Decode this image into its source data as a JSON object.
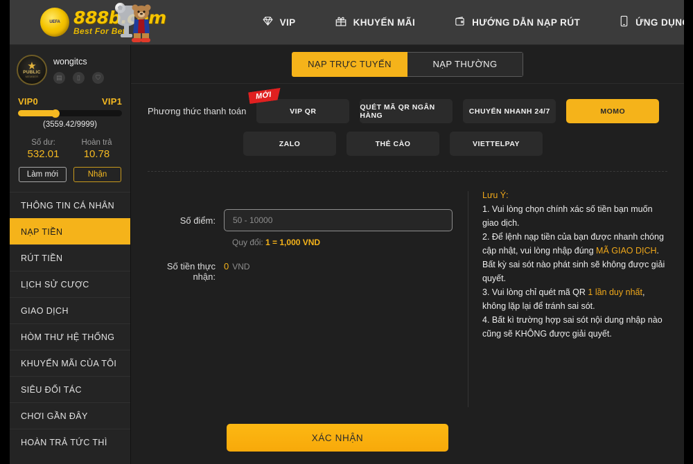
{
  "brand": {
    "name": "888b.com",
    "tagline": "Best For Bet",
    "badge_text": "UEFA",
    "logo_icon": "soccer-ball-icon",
    "mascot_icon": "bear-mascot-icon"
  },
  "header": {
    "nav": [
      {
        "label": "VIP",
        "icon": "diamond-icon"
      },
      {
        "label": "KHUYẾN MÃI",
        "icon": "gift-icon"
      },
      {
        "label": "HƯỚNG DẪN NẠP RÚT",
        "icon": "wallet-icon"
      },
      {
        "label": "ỨNG DỤNG",
        "icon": "mobile-icon"
      }
    ]
  },
  "sidebar": {
    "profile": {
      "username": "wongitcs",
      "avatar_star": "★",
      "avatar_label": "PUBLIC",
      "avatar_sub": "MEMBER",
      "badges": [
        "card-badge-icon",
        "phone-badge-icon",
        "bank-badge-icon"
      ]
    },
    "vip": {
      "current": "VIP0",
      "next": "VIP1",
      "progress_text": "(3559.42/9999)",
      "progress_percent": 36
    },
    "balance": {
      "balance_label": "Số dư:",
      "balance_value": "532.01",
      "rebate_label": "Hoàn trả",
      "rebate_value": "10.78"
    },
    "buttons": {
      "refresh": "Làm mới",
      "claim": "Nhận"
    },
    "menu": [
      {
        "label": "THÔNG TIN CÁ NHÂN",
        "active": false
      },
      {
        "label": "NẠP TIỀN",
        "active": true
      },
      {
        "label": "RÚT TIỀN",
        "active": false
      },
      {
        "label": "LỊCH SỬ CƯỢC",
        "active": false
      },
      {
        "label": "GIAO DỊCH",
        "active": false
      },
      {
        "label": "HÒM THƯ HỆ THỐNG",
        "active": false
      },
      {
        "label": "KHUYẾN MÃI CỦA TÔI",
        "active": false
      },
      {
        "label": "SIÊU ĐỐI TÁC",
        "active": false
      },
      {
        "label": "CHƠI GẦN ĐÂY",
        "active": false
      },
      {
        "label": "HOÀN TRẢ TỨC THÌ",
        "active": false
      }
    ]
  },
  "main": {
    "tabs": [
      {
        "label": "NẠP TRỰC TUYẾN",
        "active": true
      },
      {
        "label": "NẠP THƯỜNG",
        "active": false
      }
    ],
    "payment": {
      "label": "Phương thức thanh toán",
      "ribbon": "MỚI",
      "methods_row1": [
        {
          "label": "VIP QR",
          "selected": false,
          "ribbon": "MỚI"
        },
        {
          "label": "QUÉT MÃ QR NGÂN HÀNG",
          "selected": false
        },
        {
          "label": "CHUYỂN NHANH 24/7",
          "selected": false
        },
        {
          "label": "MOMO",
          "selected": true
        }
      ],
      "methods_row2": [
        {
          "label": "ZALO",
          "selected": false
        },
        {
          "label": "THẺ CÀO",
          "selected": false
        },
        {
          "label": "VIETTELPAY",
          "selected": false
        }
      ]
    },
    "form": {
      "points_label": "Số điểm:",
      "points_placeholder": "50 - 10000",
      "points_value": "",
      "rate_prefix": "Quy đổi: ",
      "rate_value": "1 = 1,000 VND",
      "receive_label": "Số tiền thực nhận:",
      "receive_value": "0",
      "receive_currency": "VND"
    },
    "notes": {
      "title": "Lưu Ý:",
      "items": [
        {
          "pre": "1. Vui lòng chọn chính xác số tiền bạn muốn giao dịch.",
          "hi": "",
          "post": ""
        },
        {
          "pre": "2. Để lệnh nạp tiền của bạn được nhanh chóng cập nhật, vui lòng nhập đúng ",
          "hi": "MÃ GIAO DỊCH",
          "post": ". Bất kỳ sai sót nào phát sinh sẽ không được giải quyết."
        },
        {
          "pre": "3. Vui lòng chỉ quét mã QR ",
          "hi": "1 lần duy nhất",
          "post": ", không lặp lại để tránh sai sót."
        },
        {
          "pre": "4. Bất kì trường hợp sai sót nội dung nhập nào cũng sẽ KHÔNG được giải quyết.",
          "hi": "",
          "post": ""
        }
      ]
    },
    "confirm_label": "XÁC NHẬN"
  },
  "colors": {
    "accent": "#f5b31a",
    "accent_dark": "#f0a81a",
    "ribbon_red": "#e02020",
    "page_bg": "#1f1f1f",
    "sidebar_bg": "#242424",
    "header_bg": "#3b3b3b"
  }
}
